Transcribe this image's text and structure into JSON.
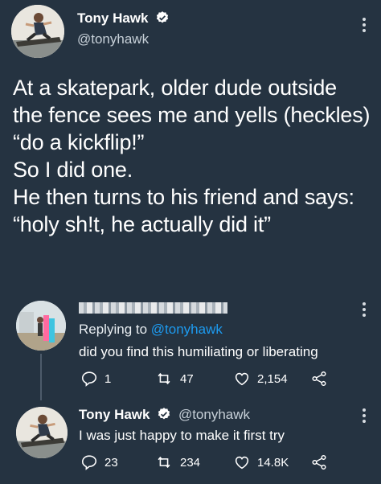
{
  "main_tweet": {
    "author_name": "Tony Hawk",
    "author_handle": "@tonyhawk",
    "text": "At a skatepark, older dude outside\nthe fence sees me and yells (heckles)\n“do a kickflip!”\nSo I did one.\nHe then turns to his friend and says:\n“holy sh!t, he actually did it”"
  },
  "reply_tweet": {
    "replying_to_prefix": "Replying to",
    "replying_to_handle": "@tonyhawk",
    "text": "did you find this humiliating or liberating",
    "replies": "1",
    "retweets": "47",
    "likes": "2,154"
  },
  "response_tweet": {
    "author_name": "Tony Hawk",
    "author_handle": "@tonyhawk",
    "text": "I was just happy to make it first try",
    "replies": "23",
    "retweets": "234",
    "likes": "14.8K"
  },
  "colors": {
    "background": "#253341",
    "verified": "#ffffff",
    "link": "#1d9bf0"
  },
  "icons": [
    "more-icon",
    "verified-icon",
    "reply-icon",
    "retweet-icon",
    "like-icon",
    "share-icon"
  ]
}
